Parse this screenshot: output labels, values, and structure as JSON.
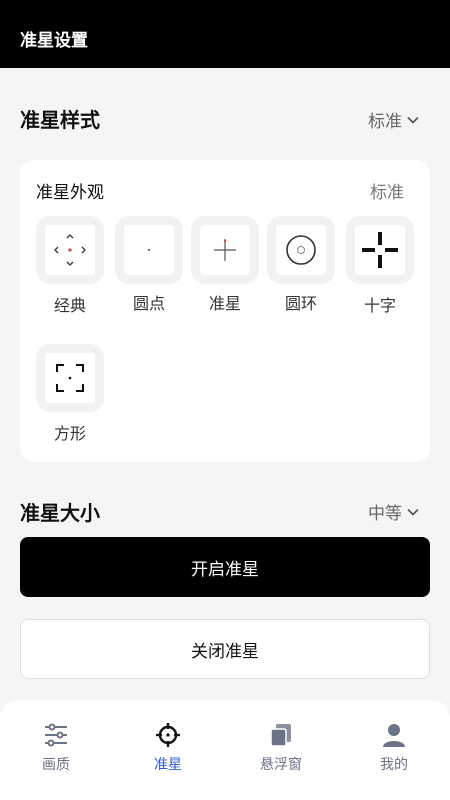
{
  "header": {
    "title": "准星设置"
  },
  "style_section": {
    "title": "准星样式",
    "value": "标准"
  },
  "appearance_card": {
    "title": "准星外观",
    "value": "标准",
    "options": [
      {
        "label": "经典",
        "icon": "classic-crosshair-icon"
      },
      {
        "label": "圆点",
        "icon": "dot-crosshair-icon"
      },
      {
        "label": "准星",
        "icon": "cross-crosshair-icon"
      },
      {
        "label": "圆环",
        "icon": "ring-crosshair-icon"
      },
      {
        "label": "十字",
        "icon": "plus-crosshair-icon"
      },
      {
        "label": "方形",
        "icon": "square-crosshair-icon"
      }
    ]
  },
  "size_section": {
    "title": "准星大小",
    "value": "中等"
  },
  "buttons": {
    "open": "开启准星",
    "close": "关闭准星"
  },
  "tabs": [
    {
      "label": "画质",
      "icon": "sliders-icon",
      "active": false
    },
    {
      "label": "准星",
      "icon": "crosshair-icon",
      "active": true
    },
    {
      "label": "悬浮窗",
      "icon": "window-stack-icon",
      "active": false
    },
    {
      "label": "我的",
      "icon": "user-icon",
      "active": false
    }
  ],
  "colors": {
    "active": "#2f5ccf",
    "inactive": "#6b7386",
    "primary": "#000000",
    "accent_red": "#e04040"
  }
}
